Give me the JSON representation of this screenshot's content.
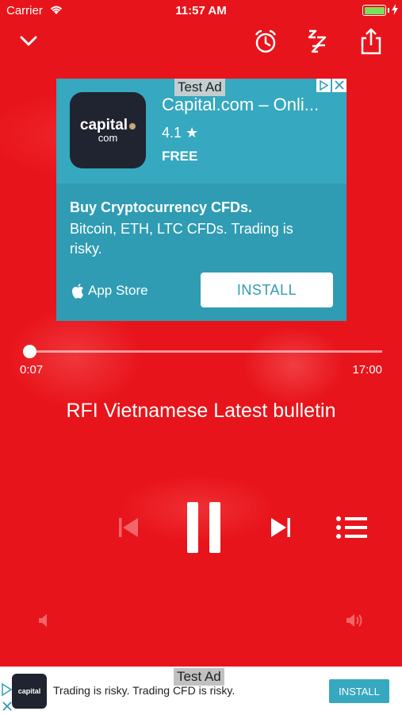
{
  "status_bar": {
    "carrier": "Carrier",
    "time": "11:57 AM"
  },
  "icons": {
    "collapse": "chevron-down-icon",
    "alarm": "alarm-clock-icon",
    "sleep": "sleep-zzz-icon",
    "share": "share-icon",
    "prev": "skip-previous-icon",
    "pause": "pause-icon",
    "next": "skip-next-icon",
    "playlist": "playlist-icon",
    "volume_low": "volume-low-icon",
    "volume_high": "volume-high-icon"
  },
  "ad": {
    "label": "Test Ad",
    "app_name": "Capital.com – Onli...",
    "logo_main": "capital",
    "logo_sub": "com",
    "rating": "4.1 ★",
    "price": "FREE",
    "headline": "Buy Cryptocurrency CFDs.",
    "body": "Bitcoin, ETH, LTC CFDs. Trading is risky.",
    "store": "App Store",
    "install_label": "INSTALL"
  },
  "player": {
    "elapsed": "0:07",
    "duration": "17:00",
    "progress_fraction": 0.007,
    "track_title": "RFI Vietnamese Latest bulletin"
  },
  "bottom_ad": {
    "label": "Test Ad",
    "logo_text": "capital",
    "text": "Trading is risky. Trading CFD is risky.",
    "install_label": "INSTALL"
  },
  "colors": {
    "background": "#e8141b",
    "ad_background": "#2f9cb3",
    "battery": "#7be05a"
  }
}
